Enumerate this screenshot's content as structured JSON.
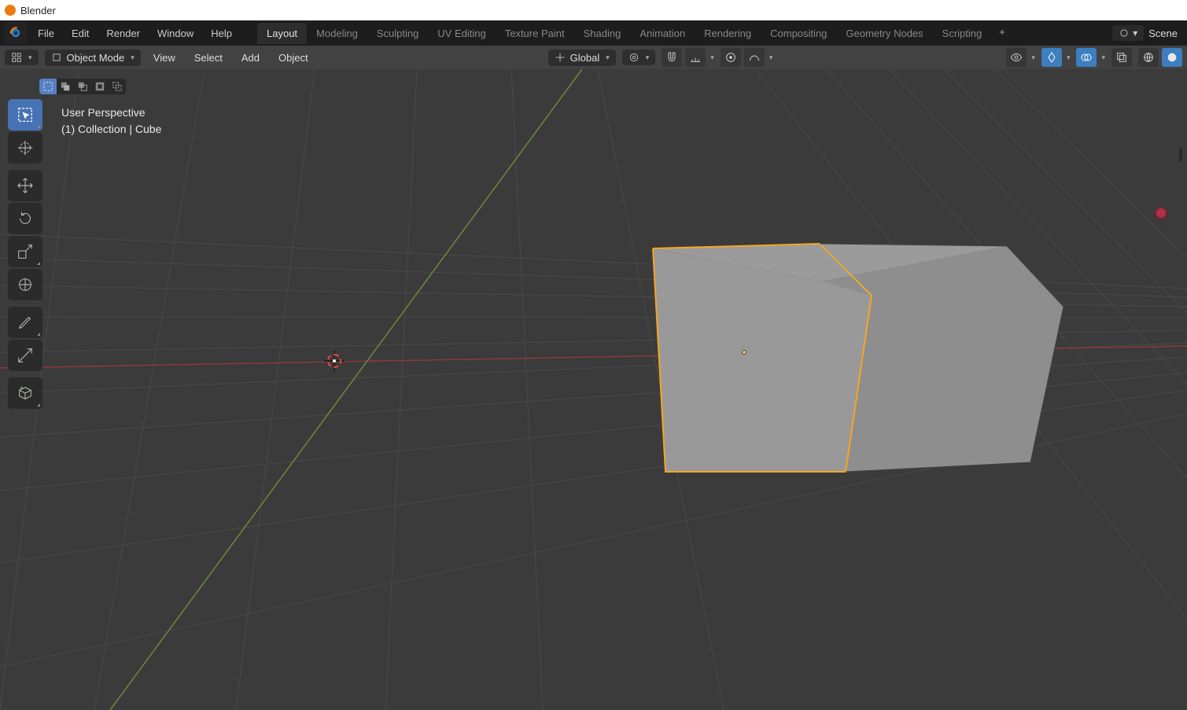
{
  "titlebar": {
    "title": "Blender"
  },
  "menus": {
    "file": "File",
    "edit": "Edit",
    "render": "Render",
    "window": "Window",
    "help": "Help"
  },
  "workspaces": [
    "Layout",
    "Modeling",
    "Sculpting",
    "UV Editing",
    "Texture Paint",
    "Shading",
    "Animation",
    "Rendering",
    "Compositing",
    "Geometry Nodes",
    "Scripting"
  ],
  "active_workspace": "Layout",
  "scene_label": "Scene",
  "header": {
    "mode": "Object Mode",
    "menus": [
      "View",
      "Select",
      "Add",
      "Object"
    ],
    "orientation": "Global"
  },
  "viewport": {
    "perspective": "User Perspective",
    "collection_line": "(1) Collection | Cube"
  },
  "tools": [
    {
      "name": "select-box",
      "active": true
    },
    {
      "name": "cursor"
    },
    {
      "name": "move"
    },
    {
      "name": "rotate"
    },
    {
      "name": "scale"
    },
    {
      "name": "transform"
    },
    {
      "name": "annotate",
      "newgroup": true
    },
    {
      "name": "measure"
    },
    {
      "name": "add-cube",
      "newgroup": true
    }
  ]
}
